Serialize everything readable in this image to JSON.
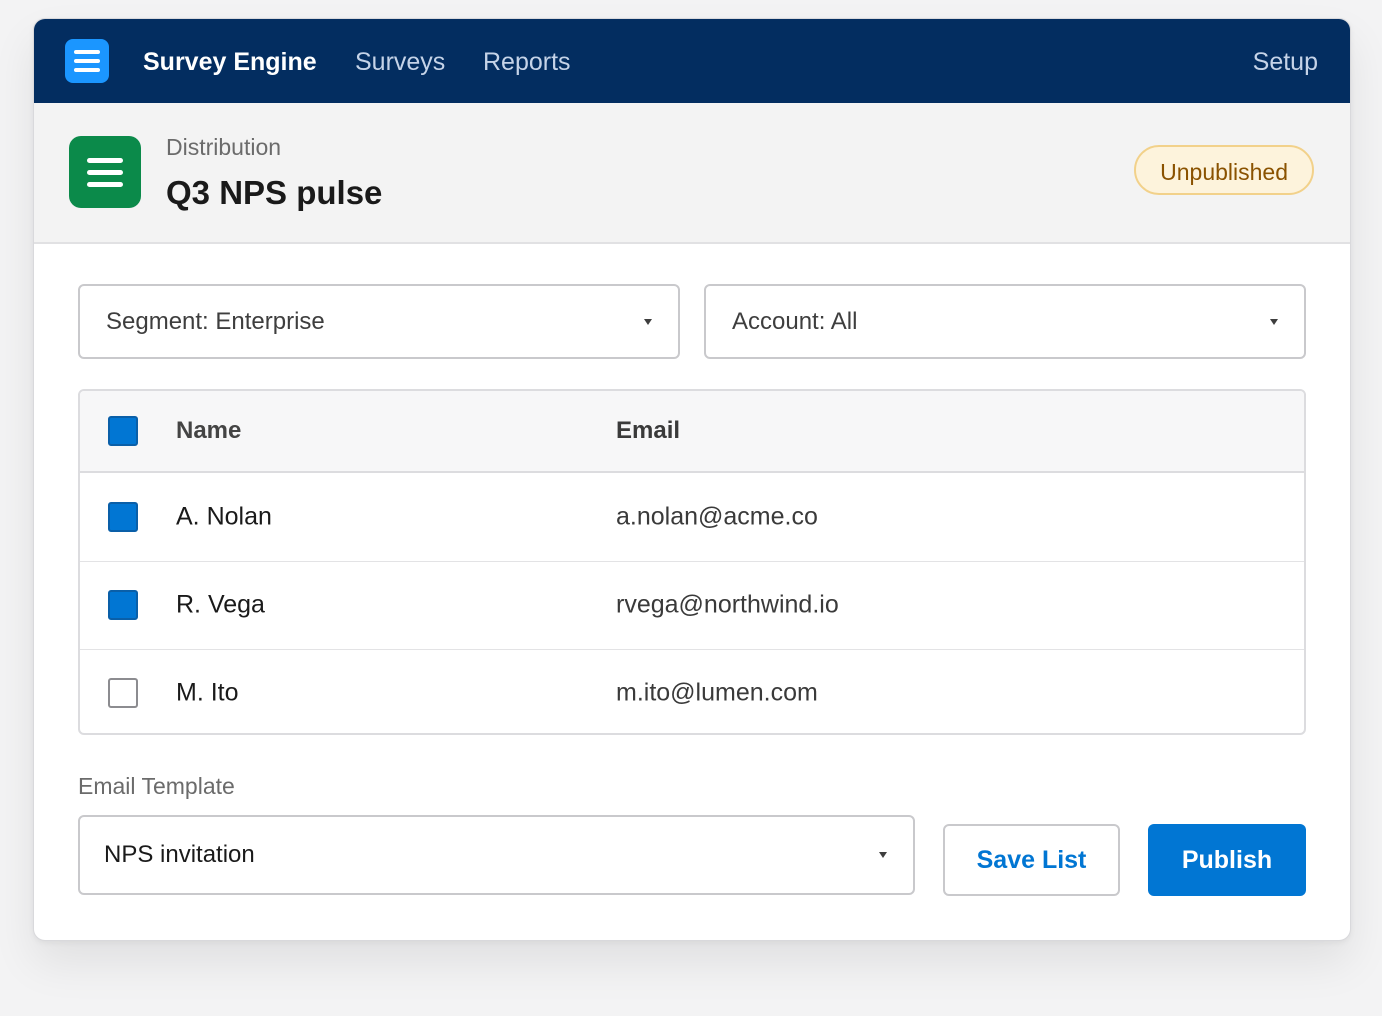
{
  "nav": {
    "app_name": "Survey Engine",
    "links": [
      "Surveys",
      "Reports"
    ],
    "setup": "Setup",
    "brand_color": "#032d60"
  },
  "record": {
    "object_label": "Distribution",
    "title": "Q3 NPS pulse",
    "status": "Unpublished",
    "icon": "list-icon"
  },
  "filters": {
    "segment": "Segment: Enterprise",
    "account": "Account: All"
  },
  "table": {
    "columns": [
      "Name",
      "Email"
    ],
    "header_checked": true,
    "rows": [
      {
        "name": "A. Nolan",
        "email": "a.nolan@acme.co",
        "checked": true
      },
      {
        "name": "R. Vega",
        "email": "rvega@northwind.io",
        "checked": true
      },
      {
        "name": "M. Ito",
        "email": "m.ito@lumen.com",
        "checked": false
      }
    ]
  },
  "template": {
    "label": "Email Template",
    "value": "NPS invitation"
  },
  "actions": {
    "save_label": "Save List",
    "publish_label": "Publish",
    "accent_color": "#0176d3"
  }
}
